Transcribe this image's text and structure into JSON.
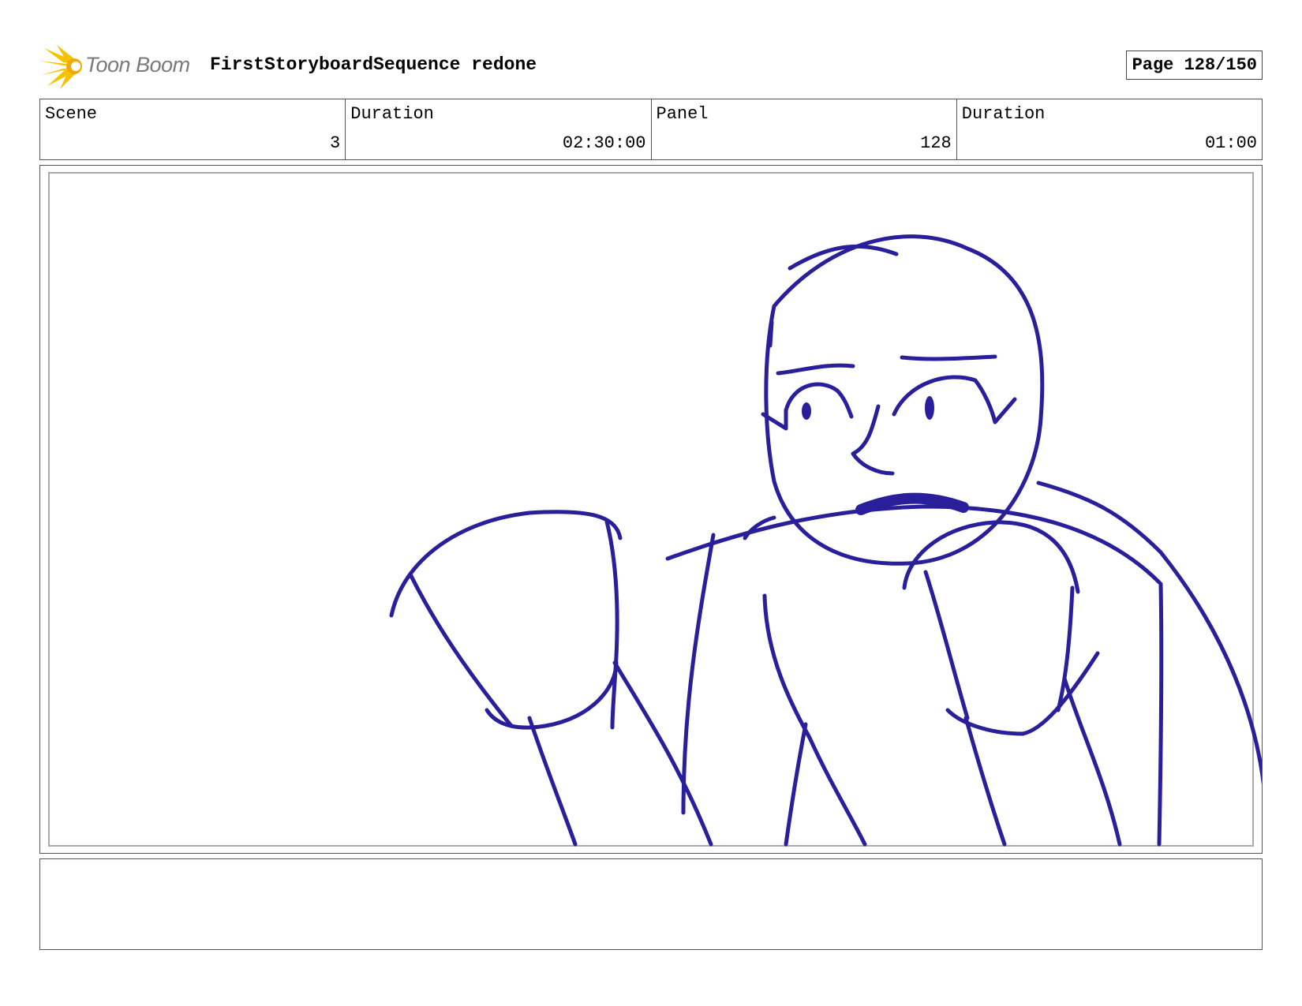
{
  "header": {
    "logo_text": "Toon Boom",
    "title": "FirstStoryboardSequence redone",
    "page_label": "Page 128/150"
  },
  "info": [
    {
      "label": "Scene",
      "value": "3"
    },
    {
      "label": "Duration",
      "value": "02:30:00"
    },
    {
      "label": "Panel",
      "value": "128"
    },
    {
      "label": "Duration",
      "value": "01:00"
    }
  ],
  "sketch": {
    "stroke_color": "#2a1f9a"
  },
  "notes": {
    "text": ""
  }
}
